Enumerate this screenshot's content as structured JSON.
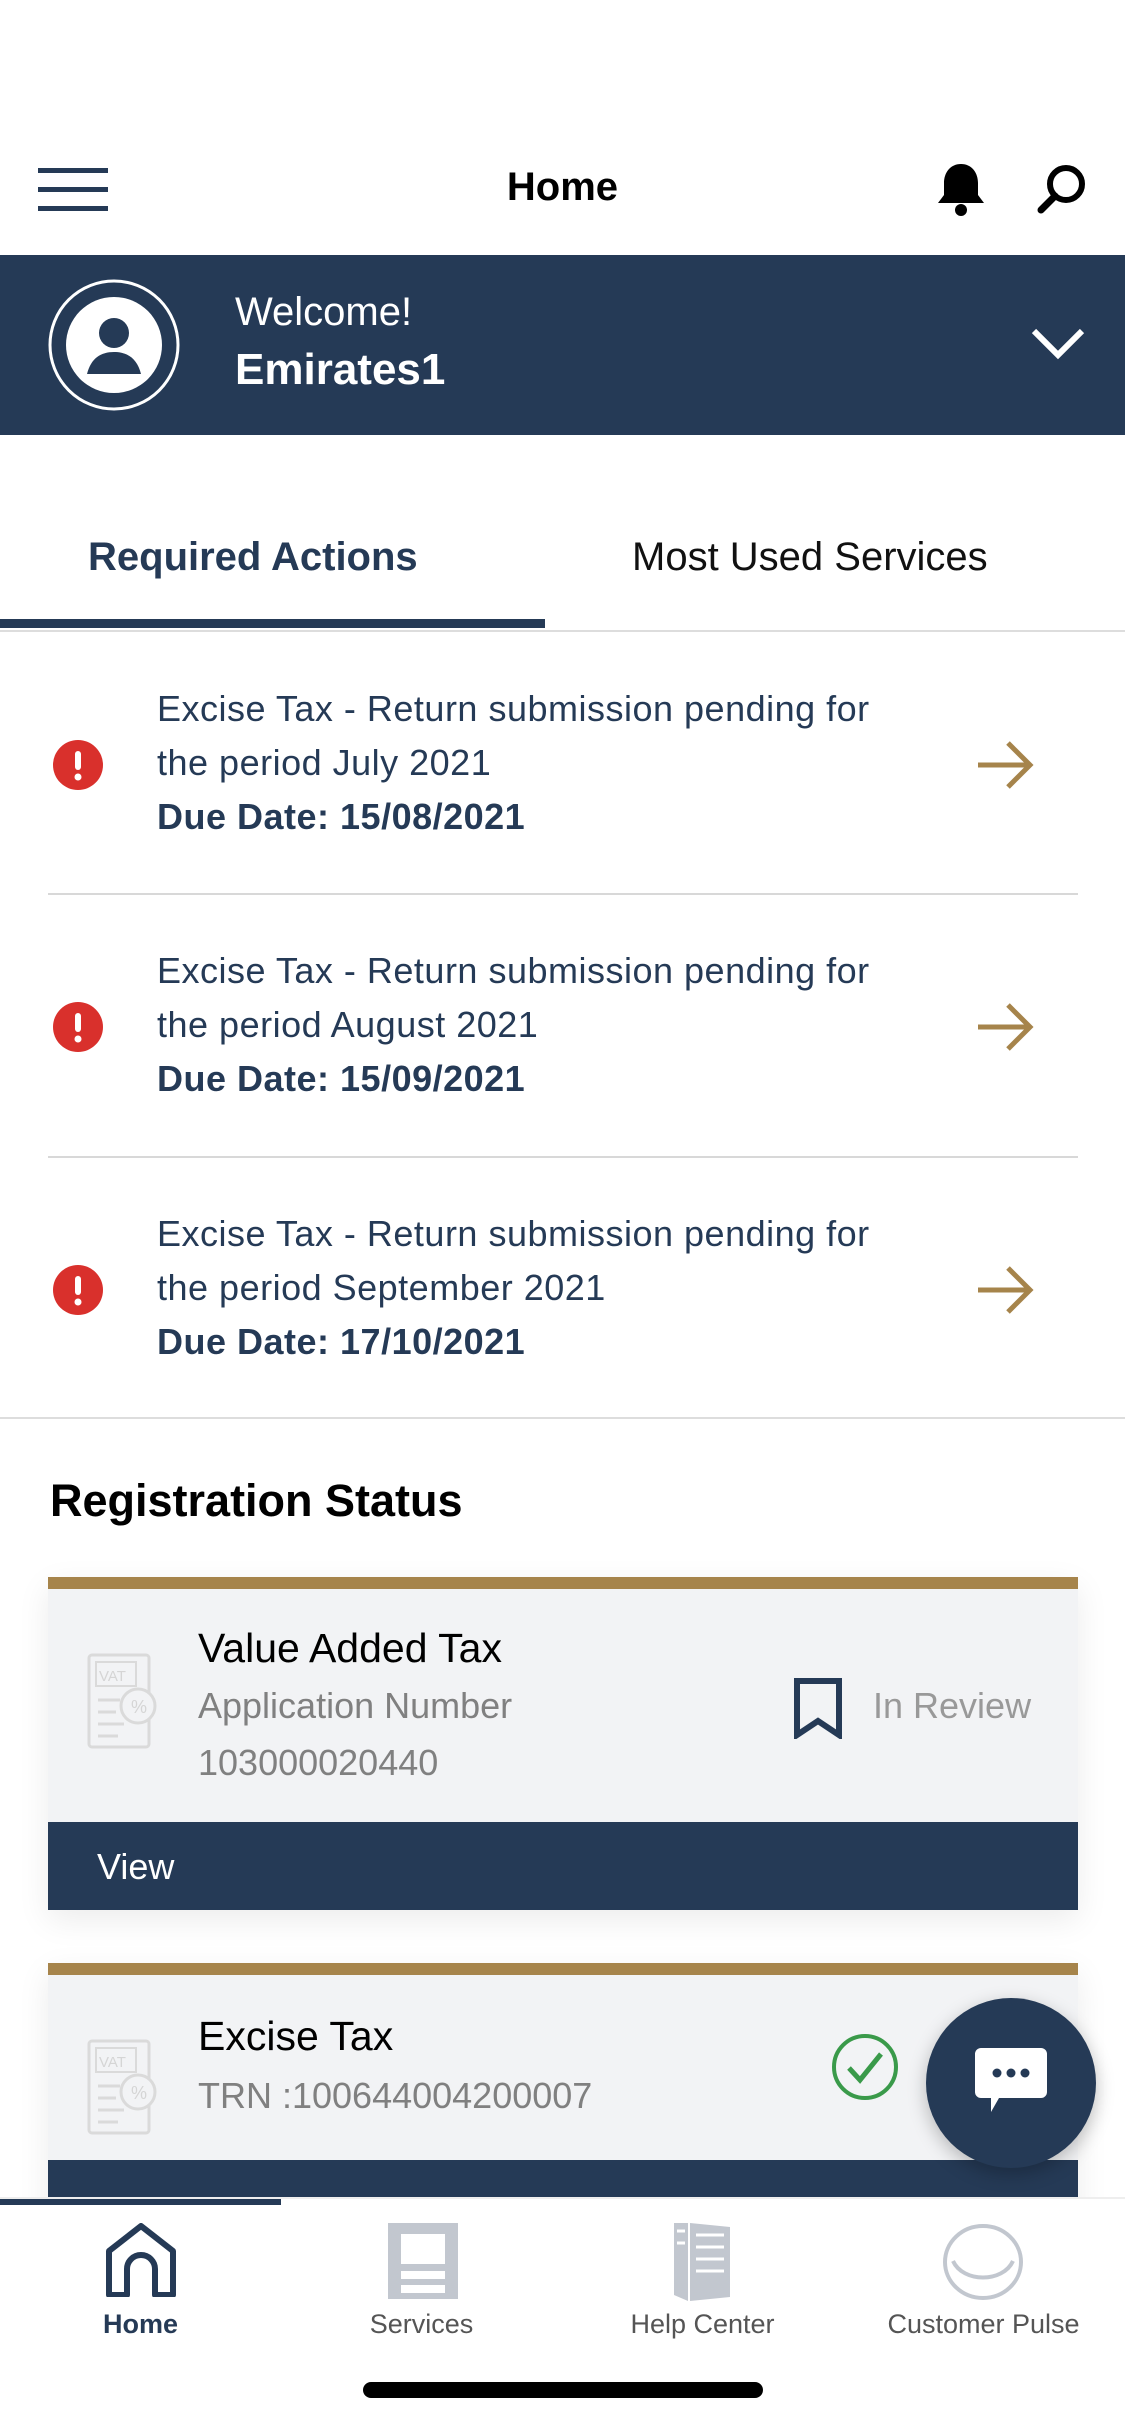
{
  "header": {
    "title": "Home"
  },
  "welcome": {
    "greeting": "Welcome!",
    "username": "Emirates1"
  },
  "tabs": [
    {
      "label": "Required Actions",
      "active": true
    },
    {
      "label": "Most Used Services",
      "active": false
    }
  ],
  "actions": [
    {
      "line1": "Excise Tax - Return submission pending for",
      "line2": "the period July 2021",
      "due": "Due Date: 15/08/2021"
    },
    {
      "line1": "Excise Tax - Return submission pending for",
      "line2": "the period August 2021",
      "due": "Due Date: 15/09/2021"
    },
    {
      "line1": "Excise Tax - Return submission pending for",
      "line2": "the period September 2021",
      "due": "Due Date: 17/10/2021"
    }
  ],
  "registration": {
    "title": "Registration Status",
    "cards": [
      {
        "title": "Value Added Tax",
        "label": "Application Number",
        "number": "103000020440",
        "status": "In Review",
        "button": "View"
      },
      {
        "title": "Excise Tax",
        "trn": "TRN :100644004200007",
        "status_icon": "check-circle-icon"
      }
    ]
  },
  "nav": [
    {
      "label": "Home",
      "active": true
    },
    {
      "label": "Services"
    },
    {
      "label": "Help Center"
    },
    {
      "label": "Customer Pulse"
    }
  ],
  "colors": {
    "primary": "#253a56",
    "gold": "#a6844b",
    "alert": "#d9302c",
    "success": "#3a9a4a"
  }
}
